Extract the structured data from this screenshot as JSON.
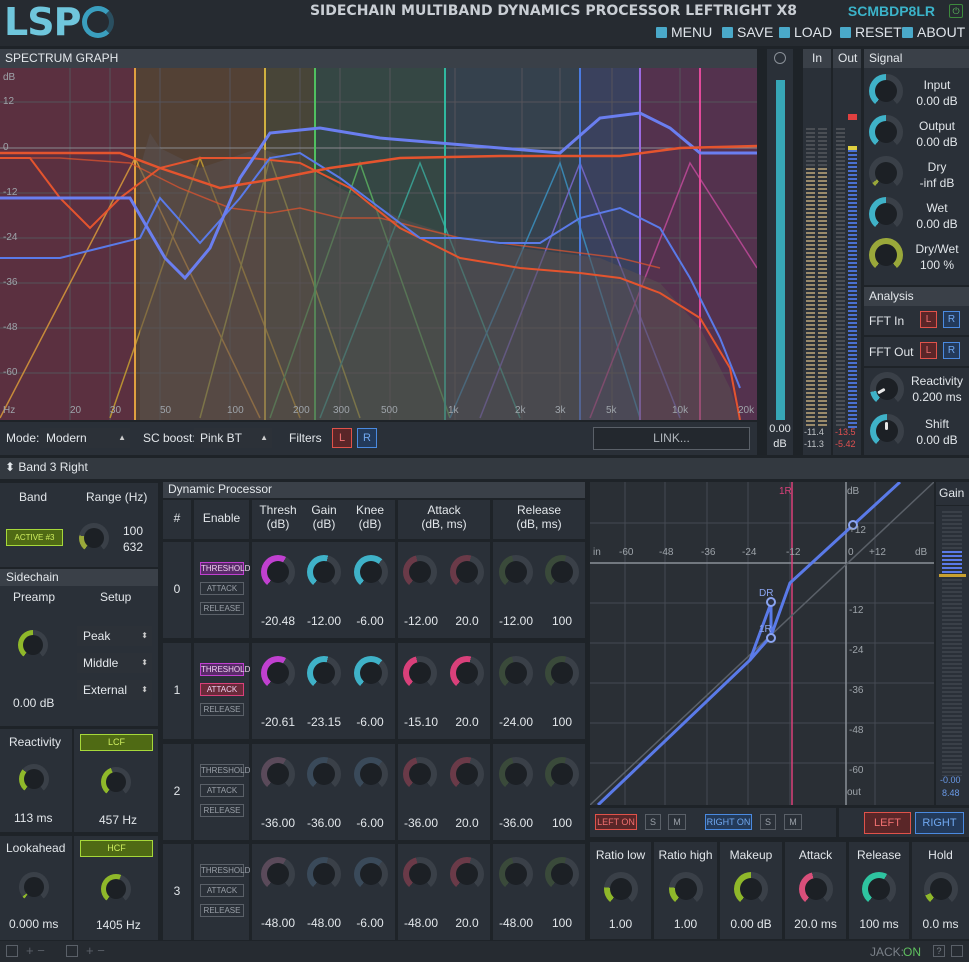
{
  "header": {
    "logo": "LSP",
    "title": "SIDECHAIN MULTIBAND DYNAMICS PROCESSOR LEFTRIGHT X8",
    "code": "SCMBDP8LR",
    "menu": "MENU",
    "save": "SAVE",
    "load": "LOAD",
    "reset": "RESET",
    "about": "ABOUT"
  },
  "spectrum": {
    "title": "SPECTRUM GRAPH",
    "db_unit": "dB",
    "y_ticks": [
      "12",
      "0",
      "-12",
      "-24",
      "-36",
      "-48",
      "-60"
    ],
    "x_ticks": [
      "Hz",
      "20",
      "30",
      "50",
      "100",
      "200",
      "300",
      "500",
      "1k",
      "2k",
      "3k",
      "5k",
      "10k",
      "20k"
    ]
  },
  "bottom_bar": {
    "mode_label": "Mode:",
    "mode_value": "Modern",
    "sc_label": "SC boost:",
    "sc_value": "Pink BT",
    "filters_label": "Filters",
    "filter_l": "L",
    "filter_r": "R",
    "link": "LINK..."
  },
  "meters": {
    "in_label": "In",
    "out_label": "Out",
    "level": "0.00",
    "level_unit": "dB",
    "in_l": "-11.4",
    "in_r": "-11.3",
    "out_l": "-13.5",
    "out_r": "-5.42"
  },
  "signal": {
    "title": "Signal",
    "knobs": [
      {
        "label": "Input",
        "value": "0.00 dB",
        "color": "#3fb2c8"
      },
      {
        "label": "Output",
        "value": "0.00 dB",
        "color": "#3fb2c8"
      },
      {
        "label": "Dry",
        "value": "-inf dB",
        "color": "#9aa83a"
      },
      {
        "label": "Wet",
        "value": "0.00 dB",
        "color": "#3fb2c8"
      },
      {
        "label": "Dry/Wet",
        "value": "100 %",
        "color": "#9aa83a"
      }
    ]
  },
  "analysis": {
    "title": "Analysis",
    "fft_in": "FFT In",
    "fft_out": "FFT Out",
    "l": "L",
    "r": "R",
    "reactivity_label": "Reactivity",
    "reactivity_value": "0.200 ms",
    "shift_label": "Shift",
    "shift_value": "0.00 dB"
  },
  "band": {
    "title": "Band 3 Right",
    "band_label": "Band",
    "band_active": "ACTIVE #3",
    "range_label": "Range (Hz)",
    "range_lo": "100",
    "range_hi": "632",
    "sidechain_title": "Sidechain",
    "preamp_label": "Preamp",
    "preamp_value": "0.00 dB",
    "setup_label": "Setup",
    "setup_options": [
      "Peak",
      "Middle",
      "External"
    ],
    "reactivity_label": "Reactivity",
    "reactivity_value": "113 ms",
    "lcf": "LCF",
    "lcf_value": "457 Hz",
    "lookahead_label": "Lookahead",
    "lookahead_value": "0.000 ms",
    "hcf": "HCF",
    "hcf_value": "1405 Hz"
  },
  "dynproc": {
    "title": "Dynamic Processor",
    "col_num": "#",
    "col_enable": "Enable",
    "col_thresh": "Thresh",
    "col_thresh_u": "(dB)",
    "col_gain": "Gain",
    "col_gain_u": "(dB)",
    "col_knee": "Knee",
    "col_knee_u": "(dB)",
    "col_attack": "Attack",
    "col_attack_u": "(dB, ms)",
    "col_release": "Release",
    "col_release_u": "(dB, ms)",
    "btn_threshold": "THRESHOLD",
    "btn_attack": "ATTACK",
    "btn_release": "RELEASE",
    "rows": [
      {
        "num": "0",
        "thresh": "-20.48",
        "gain": "-12.00",
        "knee": "-6.00",
        "att_db": "-12.00",
        "att_ms": "20.0",
        "rel_db": "-12.00",
        "rel_ms": "100"
      },
      {
        "num": "1",
        "thresh": "-20.61",
        "gain": "-23.15",
        "knee": "-6.00",
        "att_db": "-15.10",
        "att_ms": "20.0",
        "rel_db": "-24.00",
        "rel_ms": "100"
      },
      {
        "num": "2",
        "thresh": "-36.00",
        "gain": "-36.00",
        "knee": "-6.00",
        "att_db": "-36.00",
        "att_ms": "20.0",
        "rel_db": "-36.00",
        "rel_ms": "100"
      },
      {
        "num": "3",
        "thresh": "-48.00",
        "gain": "-48.00",
        "knee": "-6.00",
        "att_db": "-48.00",
        "att_ms": "20.0",
        "rel_db": "-48.00",
        "rel_ms": "100"
      }
    ]
  },
  "curve": {
    "in": "in",
    "out": "out",
    "db": "dB",
    "x_ticks": [
      "-60",
      "-48",
      "-36",
      "-24",
      "-12",
      "0",
      "+12"
    ],
    "y_ticks": [
      "+12",
      "-12",
      "-24",
      "-36",
      "-48",
      "-60"
    ],
    "marker_1r": "1R",
    "marker_dr": "DR",
    "marker_1r2": "1R",
    "gain_label": "Gain",
    "gain_v1": "-0.00",
    "gain_v2": "8.48"
  },
  "channel": {
    "left_on": "LEFT ON",
    "s": "S",
    "m": "M",
    "right_on": "RIGHT ON",
    "left": "LEFT",
    "right": "RIGHT"
  },
  "bottom_knobs": [
    {
      "label": "Ratio low",
      "value": "1.00",
      "color": "#8fb82a"
    },
    {
      "label": "Ratio high",
      "value": "1.00",
      "color": "#8fb82a"
    },
    {
      "label": "Makeup",
      "value": "0.00 dB",
      "color": "#8fb82a"
    },
    {
      "label": "Attack",
      "value": "20.0 ms",
      "color": "#d94f7a"
    },
    {
      "label": "Release",
      "value": "100 ms",
      "color": "#2ec4a0"
    },
    {
      "label": "Hold",
      "value": "0.0 ms",
      "color": "#8fb82a"
    }
  ],
  "status": {
    "jack": "JACK:",
    "jack_state": "ON"
  }
}
